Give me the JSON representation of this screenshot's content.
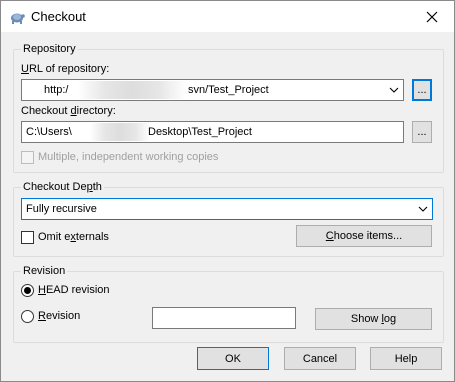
{
  "window": {
    "title": "Checkout",
    "close_icon": "close-icon",
    "app_icon": "tortoise-svn-icon"
  },
  "repository": {
    "group_label": "Repository",
    "url_label": "URL of repository:",
    "url_prefix": "http:/",
    "url_suffix": "svn/Test_Project",
    "browse_label": "...",
    "checkout_dir_label": "Checkout directory:",
    "checkout_dir_prefix": "C:\\Users\\",
    "checkout_dir_suffix": "Desktop\\Test_Project",
    "browse_dir_label": "...",
    "multiple_wc_label": "Multiple, independent working copies"
  },
  "depth": {
    "group_label": "Checkout Depth",
    "selected": "Fully recursive",
    "omit_externals_label": "Omit externals",
    "choose_items_label": "Choose items..."
  },
  "revision": {
    "group_label": "Revision",
    "head_label": "HEAD revision",
    "revision_label": "Revision",
    "revision_value": "",
    "show_log_label": "Show log"
  },
  "buttons": {
    "ok": "OK",
    "cancel": "Cancel",
    "help": "Help"
  }
}
